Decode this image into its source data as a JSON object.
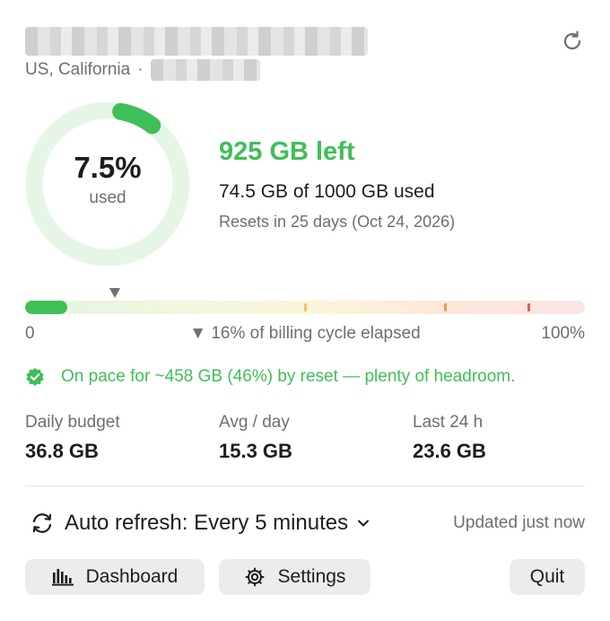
{
  "header": {
    "account_name_redacted": true,
    "location": "US, California",
    "separator": "·",
    "plan_redacted": true,
    "refresh_icon": "refresh-icon"
  },
  "usage": {
    "percent_used_label": "7.5%",
    "percent_used": 7.5,
    "used_word": "used",
    "left_label": "925 GB left",
    "used_line": "74.5 GB of 1000 GB used",
    "reset_line": "Resets in 25 days (Oct 24, 2026)"
  },
  "cycle_bar": {
    "fill_fraction": 0.075,
    "elapsed_fraction": 0.16,
    "threshold_fractions": [
      0.5,
      0.75,
      0.9
    ],
    "scale_min": "0",
    "scale_max": "100%",
    "elapsed_label": "▼ 16% of billing cycle elapsed"
  },
  "pace": {
    "icon": "check-badge-icon",
    "text": "On pace for ~458 GB (46%) by reset — plenty of headroom."
  },
  "stats": [
    {
      "label": "Daily budget",
      "value": "36.8 GB"
    },
    {
      "label": "Avg / day",
      "value": "15.3 GB"
    },
    {
      "label": "Last 24 h",
      "value": "23.6 GB"
    }
  ],
  "auto_refresh": {
    "label": "Auto refresh: Every 5 minutes",
    "updated": "Updated just now"
  },
  "buttons": {
    "dashboard": "Dashboard",
    "settings": "Settings",
    "quit": "Quit"
  },
  "colors": {
    "accent_green": "#3fbf57",
    "ring_track": "#e5f6e6",
    "warn_yellow": "#f5c55a",
    "warn_orange": "#f09a4c",
    "warn_red": "#e85a5a"
  }
}
